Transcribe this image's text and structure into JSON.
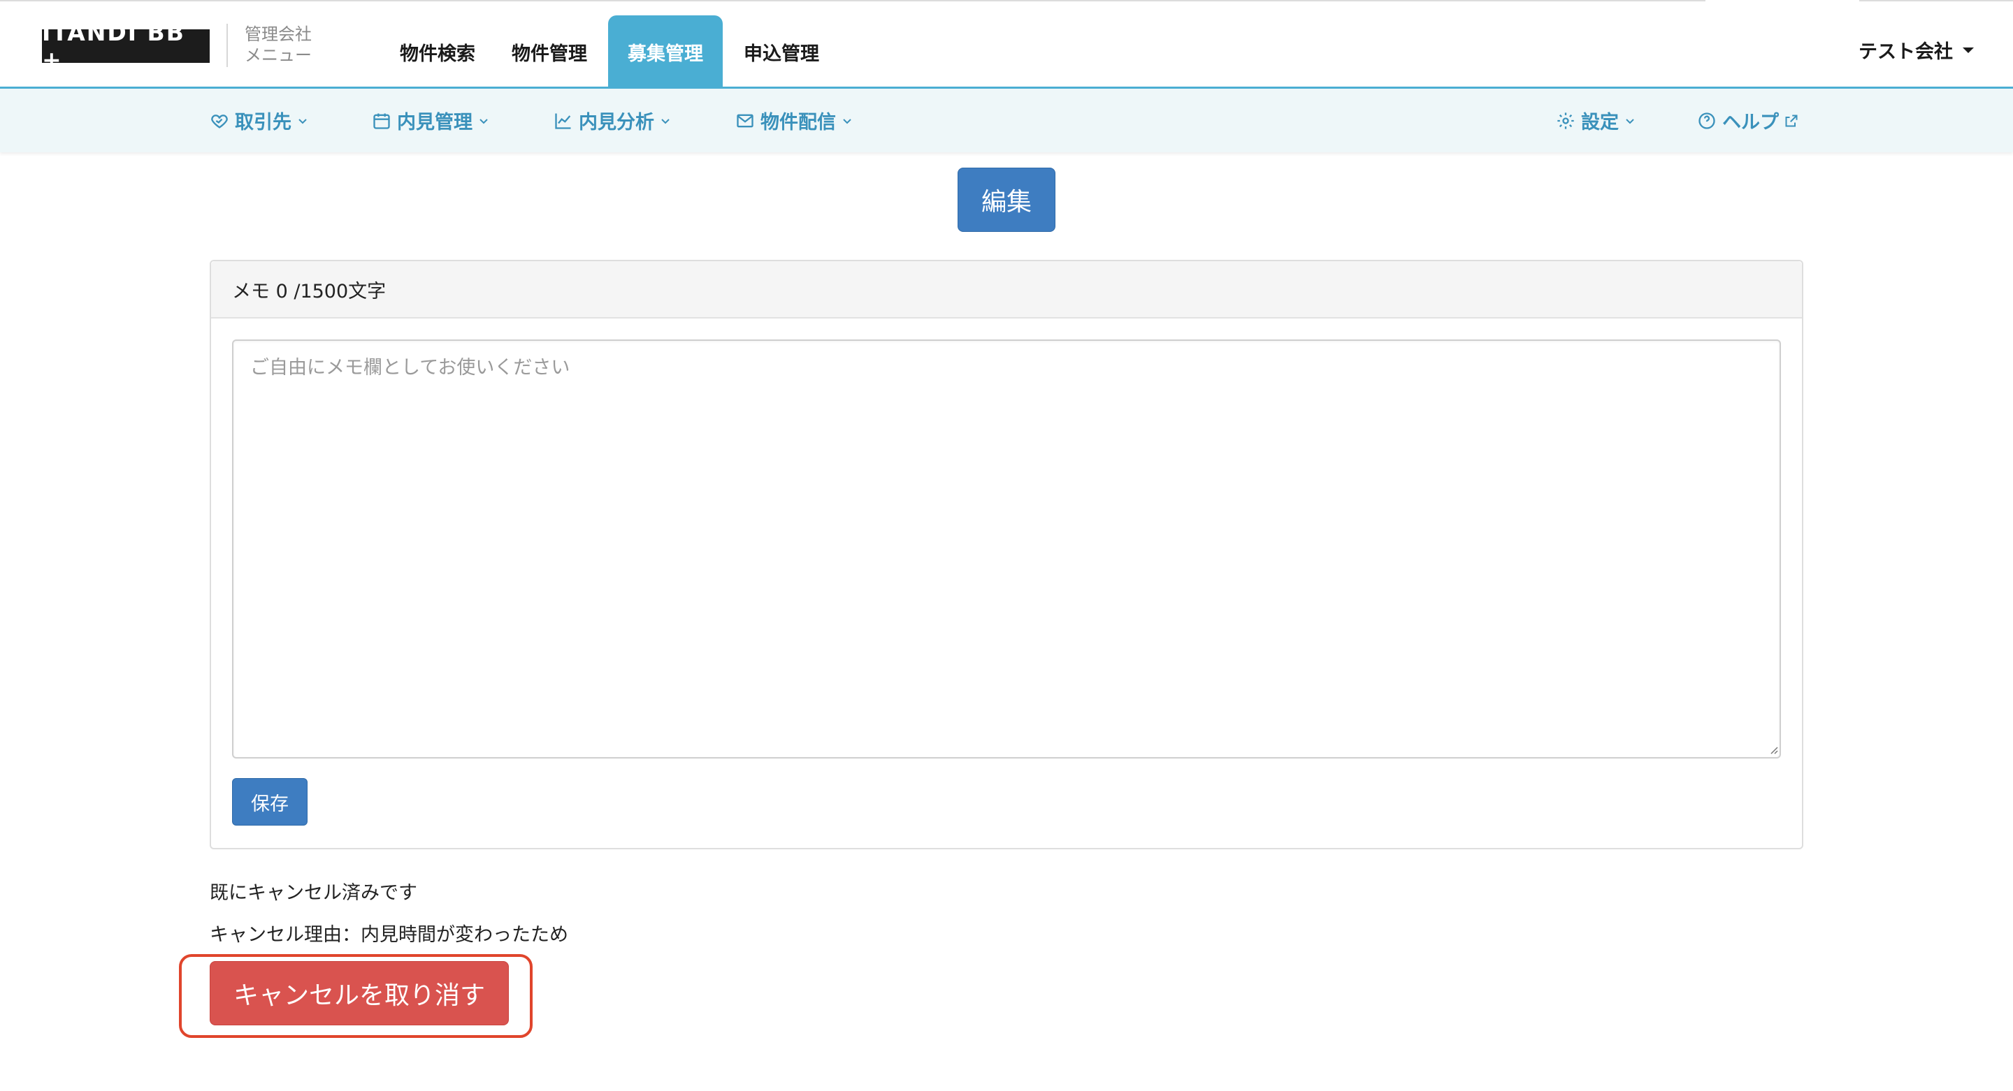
{
  "header": {
    "logo_text": "ITANDI BB +",
    "logo_sub_line1": "管理会社",
    "logo_sub_line2": "メニュー",
    "nav_items": [
      {
        "label": "物件検索",
        "active": false
      },
      {
        "label": "物件管理",
        "active": false
      },
      {
        "label": "募集管理",
        "active": true
      },
      {
        "label": "申込管理",
        "active": false
      }
    ],
    "user_label": "テスト会社",
    "accent_color": "#4aaed3"
  },
  "subnav": {
    "items": [
      {
        "label": "取引先",
        "icon": "handshake-heart-icon"
      },
      {
        "label": "内見管理",
        "icon": "calendar-icon"
      },
      {
        "label": "内見分析",
        "icon": "line-chart-icon"
      },
      {
        "label": "物件配信",
        "icon": "mail-send-icon"
      }
    ],
    "right_items": [
      {
        "label": "設定",
        "icon": "gear-icon"
      },
      {
        "label": "ヘルプ",
        "icon": "help-circle-icon"
      }
    ],
    "link_color": "#3a91bb"
  },
  "main": {
    "edit_label": "編集",
    "memo": {
      "header_label": "メモ 0 /1500文字",
      "value": "",
      "placeholder": "ご自由にメモ欄としてお使いください",
      "save_label": "保存"
    },
    "status_line1": "既にキャンセル済みです",
    "status_line2": "キャンセル理由：内見時間が変わったため",
    "undo_cancel_label": "キャンセルを取り消す",
    "primary_color": "#3e7dc1",
    "danger_color": "#d9534f",
    "highlight_color": "#e0452c"
  }
}
